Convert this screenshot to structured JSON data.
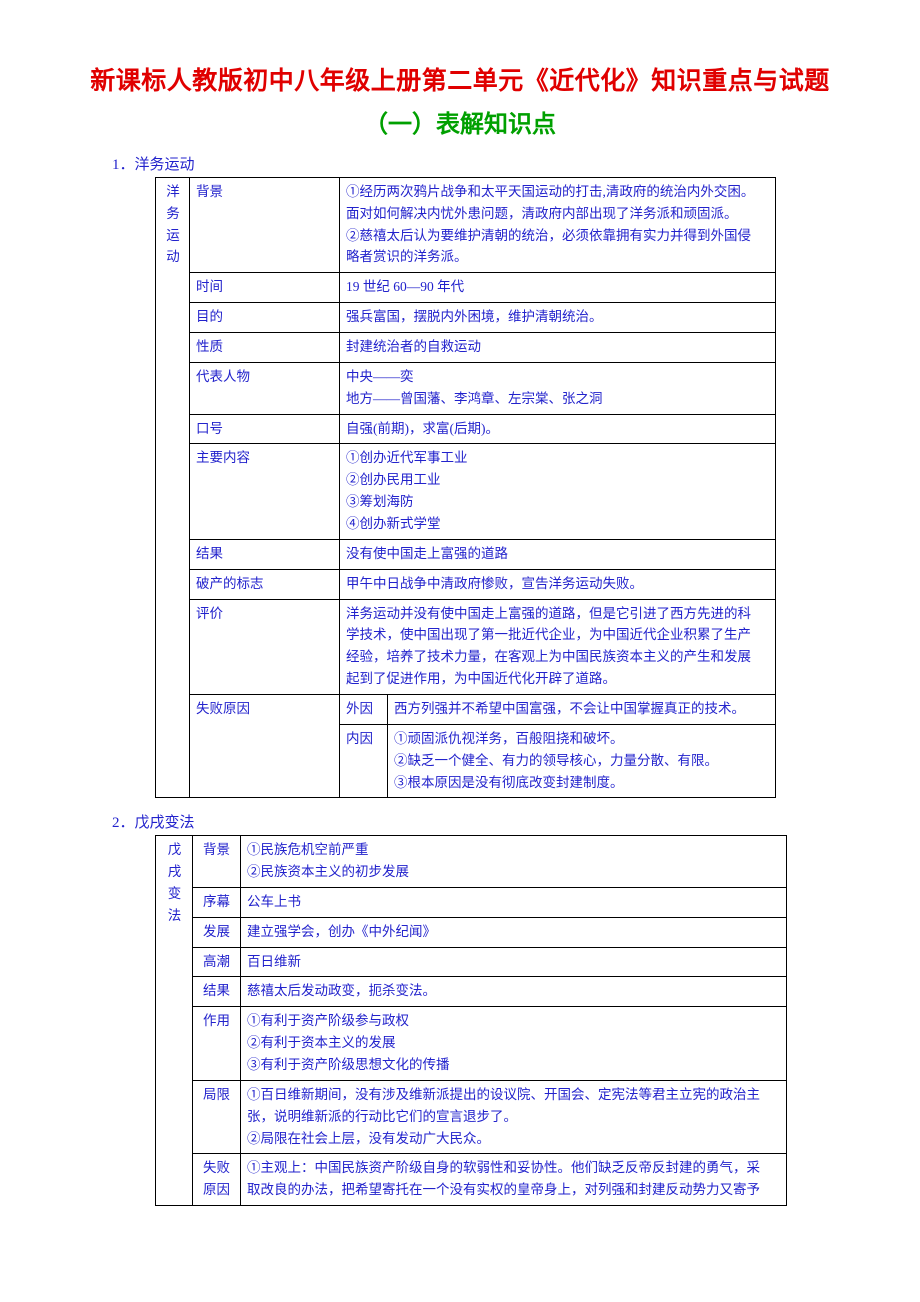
{
  "document": {
    "title": "新课标人教版初中八年级上册第二单元《近代化》知识重点与试题",
    "subtitle": "（一）表解知识点",
    "title_color": "#e00000",
    "subtitle_color": "#00a000",
    "body_color": "#2222cc"
  },
  "sections": [
    {
      "number": "1．",
      "heading": "洋务运动",
      "vertical_label": "洋务运动",
      "rows": [
        {
          "label": "背景",
          "lines": [
            "①经历两次鸦片战争和太平天国运动的打击,清政府的统治内外交困。",
            "面对如何解决内忧外患问题，清政府内部出现了洋务派和顽固派。",
            "②慈禧太后认为要维护清朝的统治，必须依靠拥有实力并得到外国侵",
            "略者赏识的洋务派。"
          ]
        },
        {
          "label": "时间",
          "lines": [
            "19 世纪 60—90 年代"
          ]
        },
        {
          "label": "目的",
          "lines": [
            "强兵富国，摆脱内外困境，维护清朝统治。"
          ]
        },
        {
          "label": "性质",
          "lines": [
            "封建统治者的自救运动"
          ]
        },
        {
          "label": "代表人物",
          "lines": [
            "中央——奕",
            "地方——曾国藩、李鸿章、左宗棠、张之洞"
          ]
        },
        {
          "label": "口号",
          "lines": [
            "自强(前期)，求富(后期)。"
          ]
        },
        {
          "label": "主要内容",
          "lines": [
            "①创办近代军事工业",
            "②创办民用工业",
            "③筹划海防",
            "④创办新式学堂"
          ]
        },
        {
          "label": "结果",
          "lines": [
            "没有使中国走上富强的道路"
          ]
        },
        {
          "label": "破产的标志",
          "lines": [
            "甲午中日战争中清政府惨败，宣告洋务运动失败。"
          ]
        },
        {
          "label": "评价",
          "lines": [
            "洋务运动并没有使中国走上富强的道路，但是它引进了西方先进的科",
            "学技术，使中国出现了第一批近代企业，为中国近代企业积累了生产",
            "经验，培养了技术力量，在客观上为中国民族资本主义的产生和发展",
            "起到了促进作用，为中国近代化开辟了道路。"
          ]
        }
      ],
      "failure": {
        "label": "失败原因",
        "sub_rows": [
          {
            "sub_label": "外因",
            "lines": [
              "西方列强并不希望中国富强，不会让中国掌握真正的技术。"
            ]
          },
          {
            "sub_label": "内因",
            "lines": [
              "①顽固派仇视洋务，百般阻挠和破坏。",
              "②缺乏一个健全、有力的领导核心，力量分散、有限。",
              "③根本原因是没有彻底改变封建制度。"
            ]
          }
        ]
      }
    },
    {
      "number": "2．",
      "heading": "戊戌变法",
      "vertical_label": "戊戌变法",
      "rows": [
        {
          "label": "背景",
          "lines": [
            "①民族危机空前严重",
            "②民族资本主义的初步发展"
          ]
        },
        {
          "label": "序幕",
          "lines": [
            "公车上书"
          ]
        },
        {
          "label": "发展",
          "lines": [
            "建立强学会，创办《中外纪闻》"
          ]
        },
        {
          "label": "高潮",
          "lines": [
            "百日维新"
          ]
        },
        {
          "label": "结果",
          "lines": [
            "慈禧太后发动政变，扼杀变法。"
          ]
        },
        {
          "label": "作用",
          "lines": [
            "①有利于资产阶级参与政权",
            "②有利于资本主义的发展",
            "③有利于资产阶级思想文化的传播"
          ]
        },
        {
          "label": "局限",
          "lines": [
            "①百日维新期间，没有涉及维新派提出的设议院、开国会、定宪法等君主立宪的政治主",
            "张，说明维新派的行动比它们的宣言退步了。",
            "②局限在社会上层，没有发动广大民众。"
          ]
        },
        {
          "label": "失败原因",
          "label_lines": [
            "失败",
            "原因"
          ],
          "lines": [
            "①主观上：中国民族资产阶级自身的软弱性和妥协性。他们缺乏反帝反封建的勇气，采",
            "取改良的办法，把希望寄托在一个没有实权的皇帝身上，对列强和封建反动势力又寄予"
          ]
        }
      ]
    }
  ]
}
